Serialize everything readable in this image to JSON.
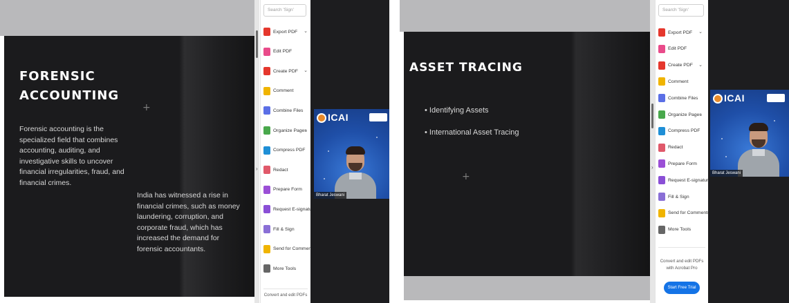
{
  "left_panel": {
    "slide": {
      "title_lines": [
        "FORENSIC",
        "ACCOUNTING"
      ],
      "crosshair": "+",
      "paragraph_1": "Forensic accounting is the specialized field that combines accounting, auditing, and investigative skills to uncover financial irregularities, fraud, and financial crimes.",
      "paragraph_2": "India has witnessed a rise in financial crimes, such as money laundering, corruption, and corporate fraud, which has increased the demand for forensic accountants."
    },
    "tools": {
      "search_placeholder": "Search 'Sign'",
      "items": [
        {
          "label": "Export PDF",
          "icon": "export-pdf-icon",
          "color": "#e5372d",
          "chevron": "⌄"
        },
        {
          "label": "Edit PDF",
          "icon": "edit-pdf-icon",
          "color": "#e94b8a",
          "chevron": ""
        },
        {
          "label": "Create PDF",
          "icon": "create-pdf-icon",
          "color": "#e5372d",
          "chevron": "⌄"
        },
        {
          "label": "Comment",
          "icon": "comment-icon",
          "color": "#f0b400",
          "chevron": ""
        },
        {
          "label": "Combine Files",
          "icon": "combine-files-icon",
          "color": "#5b6fe6",
          "chevron": ""
        },
        {
          "label": "Organize Pages",
          "icon": "organize-pages-icon",
          "color": "#49a84c",
          "chevron": "⌄"
        },
        {
          "label": "Compress PDF",
          "icon": "compress-pdf-icon",
          "color": "#1f8fd6",
          "chevron": ""
        },
        {
          "label": "Redact",
          "icon": "redact-icon",
          "color": "#e0596a",
          "chevron": ""
        },
        {
          "label": "Prepare Form",
          "icon": "prepare-form-icon",
          "color": "#9b4fd6",
          "chevron": ""
        },
        {
          "label": "Request E-signatures",
          "icon": "request-esignatures-icon",
          "color": "#8a4fd6",
          "chevron": ""
        },
        {
          "label": "Fill & Sign",
          "icon": "fill-sign-icon",
          "color": "#8a6fd6",
          "chevron": ""
        },
        {
          "label": "Send for Comments",
          "icon": "send-for-comments-icon",
          "color": "#f0b400",
          "chevron": ""
        },
        {
          "label": "More Tools",
          "icon": "more-tools-icon",
          "color": "#666666",
          "chevron": ""
        }
      ],
      "convert_text": "Convert and edit PDFs"
    },
    "video": {
      "logo_text": "ICAI",
      "name_tag": "Bharat Jeswani"
    }
  },
  "right_panel": {
    "slide": {
      "title": "ASSET TRACING",
      "bullets": [
        "• Identifying Assets",
        "• International Asset Tracing"
      ],
      "crosshair": "+"
    },
    "tools": {
      "search_placeholder": "Search 'Sign'",
      "items": [
        {
          "label": "Export PDF",
          "icon": "export-pdf-icon",
          "color": "#e5372d",
          "chevron": "⌄"
        },
        {
          "label": "Edit PDF",
          "icon": "edit-pdf-icon",
          "color": "#e94b8a",
          "chevron": ""
        },
        {
          "label": "Create PDF",
          "icon": "create-pdf-icon",
          "color": "#e5372d",
          "chevron": "⌄"
        },
        {
          "label": "Comment",
          "icon": "comment-icon",
          "color": "#f0b400",
          "chevron": ""
        },
        {
          "label": "Combine Files",
          "icon": "combine-files-icon",
          "color": "#5b6fe6",
          "chevron": ""
        },
        {
          "label": "Organize Pages",
          "icon": "organize-pages-icon",
          "color": "#49a84c",
          "chevron": "⌄"
        },
        {
          "label": "Compress PDF",
          "icon": "compress-pdf-icon",
          "color": "#1f8fd6",
          "chevron": ""
        },
        {
          "label": "Redact",
          "icon": "redact-icon",
          "color": "#e0596a",
          "chevron": ""
        },
        {
          "label": "Prepare Form",
          "icon": "prepare-form-icon",
          "color": "#9b4fd6",
          "chevron": ""
        },
        {
          "label": "Request E-signatures",
          "icon": "request-esignatures-icon",
          "color": "#8a4fd6",
          "chevron": ""
        },
        {
          "label": "Fill & Sign",
          "icon": "fill-sign-icon",
          "color": "#8a6fd6",
          "chevron": ""
        },
        {
          "label": "Send for Comments",
          "icon": "send-for-comments-icon",
          "color": "#f0b400",
          "chevron": ""
        },
        {
          "label": "More Tools",
          "icon": "more-tools-icon",
          "color": "#666666",
          "chevron": ""
        }
      ],
      "convert_text_1": "Convert and edit PDFs",
      "convert_text_2": "with Acrobat Pro",
      "trial_button": "Start Free Trial"
    },
    "video": {
      "logo_text": "ICAI",
      "name_tag": "Bharat Jeswani"
    }
  },
  "colors": {
    "slide_bg": "#1c1c1e",
    "toolbar_gray": "#b9b9bb",
    "accent_blue": "#1473e6",
    "video_bg": "#1f4fa8"
  }
}
